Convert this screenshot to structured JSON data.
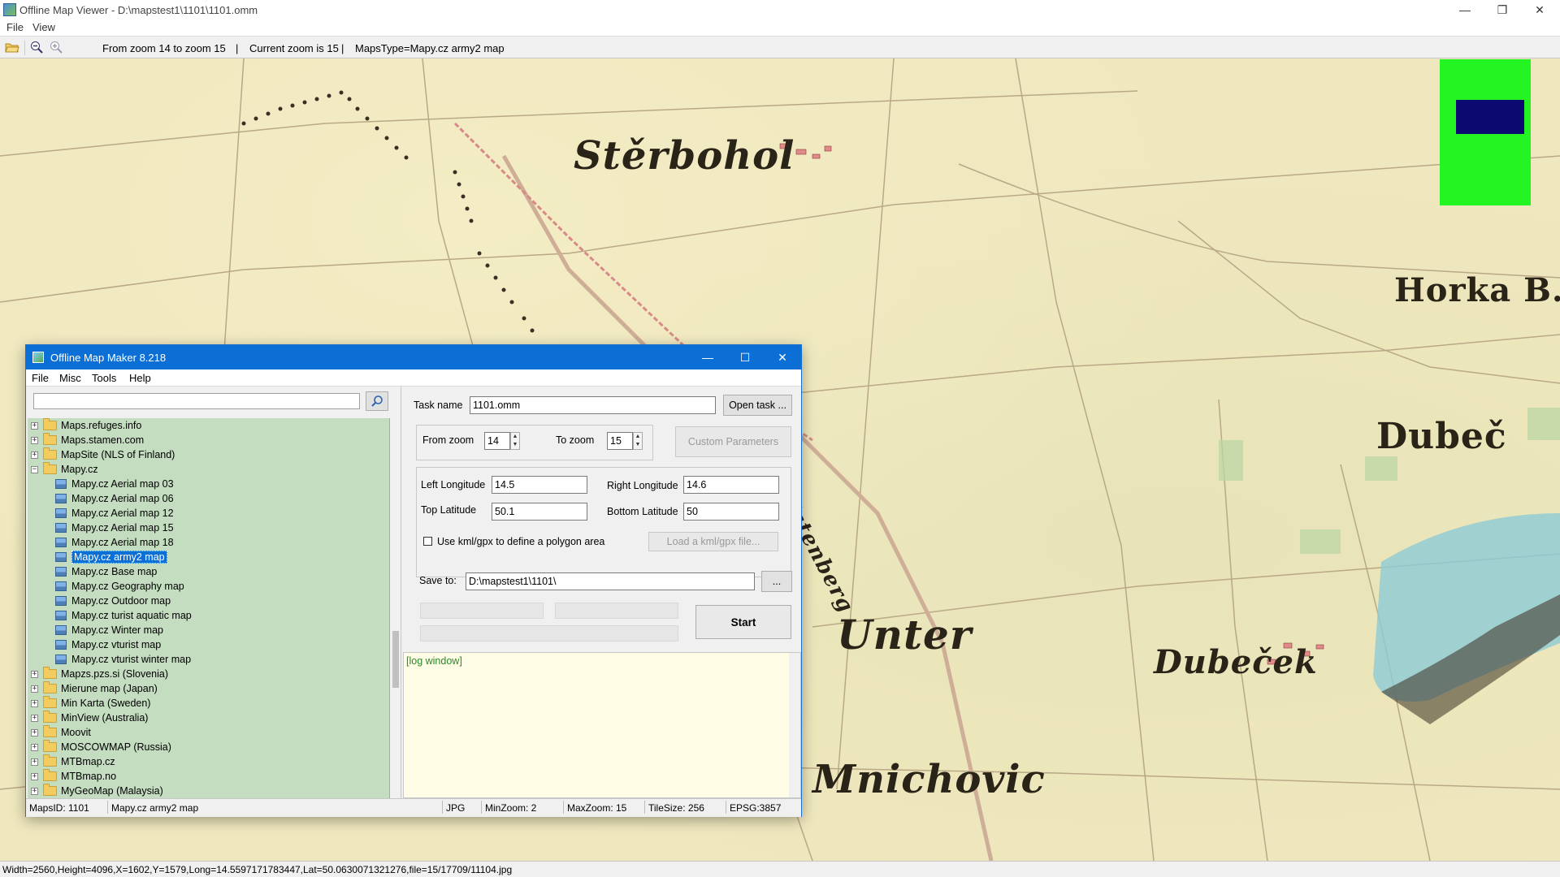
{
  "window": {
    "title": "Offline Map Viewer - D:\\mapstest1\\1101\\1101.omm",
    "controls": {
      "minimize": "—",
      "restore": "❐",
      "close": "✕"
    }
  },
  "menu": {
    "file": "File",
    "view": "View"
  },
  "toolbar": {
    "zoom_range": "From zoom 14 to zoom 15",
    "sep1": "|",
    "current_zoom": "Current zoom is 15",
    "sep2": "|",
    "maps_type": "MapsType=Mapy.cz army2 map"
  },
  "map": {
    "labels": {
      "sterbohol": "Stěrbohol",
      "horka": "Horka B.",
      "dubec": "Dubeč",
      "unter": "Unter",
      "dubecek": "Dubeček",
      "mnichovice": "Mnichovic",
      "katenberg": "Katenberg"
    },
    "colors": {
      "paper": "#efe7bd",
      "road": "#b8a98a",
      "rail": "#d88a86",
      "water": "#7fc4d4"
    }
  },
  "status": {
    "text": "Width=2560,Height=4096,X=1602,Y=1579,Long=14.5597171783447,Lat=50.0630071321276,file=15/17709/11104.jpg"
  },
  "dialog": {
    "title": "Offline Map Maker 8.218",
    "controls": {
      "minimize": "—",
      "maximize": "☐",
      "close": "✕"
    },
    "menu": {
      "file": "File",
      "misc": "Misc",
      "tools": "Tools",
      "help": "Help"
    },
    "search": {
      "value": "",
      "icon": "search-icon"
    },
    "tree": {
      "top_groups": [
        "Maps.refuges.info",
        "Maps.stamen.com",
        "MapSite (NLS of Finland)"
      ],
      "open_group": "Mapy.cz",
      "children": [
        "Mapy.cz Aerial map 03",
        "Mapy.cz Aerial map 06",
        "Mapy.cz Aerial map 12",
        "Mapy.cz Aerial map 15",
        "Mapy.cz Aerial map 18",
        "Mapy.cz army2 map",
        "Mapy.cz Base map",
        "Mapy.cz Geography map",
        "Mapy.cz Outdoor map",
        "Mapy.cz turist aquatic map",
        "Mapy.cz Winter map",
        "Mapy.cz vturist map",
        "Mapy.cz vturist winter map"
      ],
      "selected": "Mapy.cz army2 map",
      "bottom_groups": [
        "Mapzs.pzs.si (Slovenia)",
        "Mierune map (Japan)",
        "Min Karta (Sweden)",
        "MinView (Australia)",
        "Moovit",
        "MOSCOWMAP (Russia)",
        "MTBmap.cz",
        "MTBmap.no",
        "MyGeoMap (Malaysia)"
      ]
    },
    "form": {
      "task_name_label": "Task name",
      "task_name_value": "1101.omm",
      "open_task_label": "Open task ...",
      "from_zoom_label": "From zoom",
      "from_zoom_value": "14",
      "to_zoom_label": "To zoom",
      "to_zoom_value": "15",
      "custom_params_label": "Custom Parameters",
      "left_long_label": "Left Longitude",
      "left_long_value": "14.5",
      "right_long_label": "Right Longitude",
      "right_long_value": "14.6",
      "top_lat_label": "Top Latitude",
      "top_lat_value": "50.1",
      "bottom_lat_label": "Bottom Latitude",
      "bottom_lat_value": "50",
      "kml_checkbox_label": "Use kml/gpx to define a polygon area",
      "kml_checked": false,
      "load_kml_label": "Load a kml/gpx file...",
      "save_to_label": "Save to:",
      "save_to_value": "D:\\mapstest1\\1101\\",
      "browse_label": "...",
      "start_label": "Start",
      "log_text": "[log window]"
    },
    "status": {
      "maps_id": "MapsID: 1101",
      "map_name": "Mapy.cz army2 map",
      "format": "JPG",
      "min_zoom": "MinZoom: 2",
      "max_zoom": "MaxZoom: 15",
      "tile_size": "TileSize: 256",
      "epsg": "EPSG:3857"
    }
  }
}
